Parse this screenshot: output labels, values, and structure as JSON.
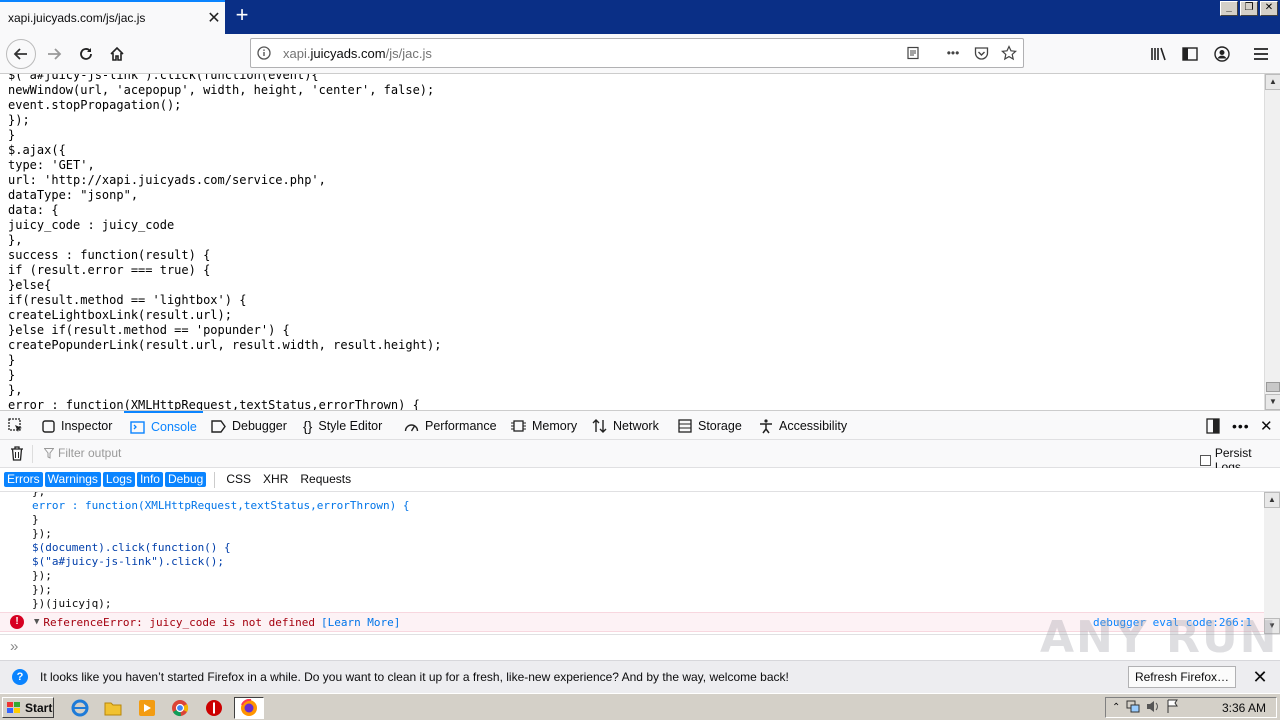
{
  "tab": {
    "title": "xapi.juicyads.com/js/jac.js"
  },
  "urlbar": {
    "prefix": "xapi.",
    "domain": "juicyads.com",
    "path": "/js/jac.js"
  },
  "page": {
    "source": "$(\"a#juicy-js-link\").click(function(event){\nnewWindow(url, 'acepopup', width, height, 'center', false);\nevent.stopPropagation();\n});\n}\n$.ajax({\ntype: 'GET',\nurl: 'http://xapi.juicyads.com/service.php',\ndataType: \"jsonp\",\ndata: {\njuicy_code : juicy_code\n},\nsuccess : function(result) {\nif (result.error === true) {\n}else{\nif(result.method == 'lightbox') {\ncreateLightboxLink(result.url);\n}else if(result.method == 'popunder') {\ncreatePopunderLink(result.url, result.width, result.height);\n}\n}\n},\nerror : function(XMLHttpRequest,textStatus,errorThrown) {"
  },
  "devtools": {
    "tabs": [
      "Inspector",
      "Console",
      "Debugger",
      "Style Editor",
      "Performance",
      "Memory",
      "Network",
      "Storage",
      "Accessibility"
    ],
    "filter_placeholder": "Filter output",
    "persist_logs": "Persist Logs",
    "filters_on": [
      "Errors",
      "Warnings",
      "Logs",
      "Info",
      "Debug"
    ],
    "filters_off": [
      "CSS",
      "XHR",
      "Requests"
    ],
    "console_lines": [
      "},",
      "error : function(XMLHttpRequest,textStatus,errorThrown) {",
      "}",
      "});",
      "$(document).click(function() {",
      "$(\"a#juicy-js-link\").click();",
      "});",
      "});",
      "})(juicyjq);"
    ],
    "error": {
      "message": "ReferenceError: juicy_code is not defined",
      "learn_more": "[Learn More]",
      "location": "debugger eval code:266:1"
    },
    "prompt": "»"
  },
  "notification": {
    "message": "It looks like you haven’t started Firefox in a while. Do you want to clean it up for a fresh, like-new experience? And by the way, welcome back!",
    "button": "Refresh Firefox…"
  },
  "taskbar": {
    "start": "Start",
    "clock": "3:36 AM"
  },
  "watermark": "ANY RUN",
  "colors": {
    "accent": "#0a84ff",
    "titlebar": "#0a2f86",
    "error_bg": "#fdf2f5"
  }
}
